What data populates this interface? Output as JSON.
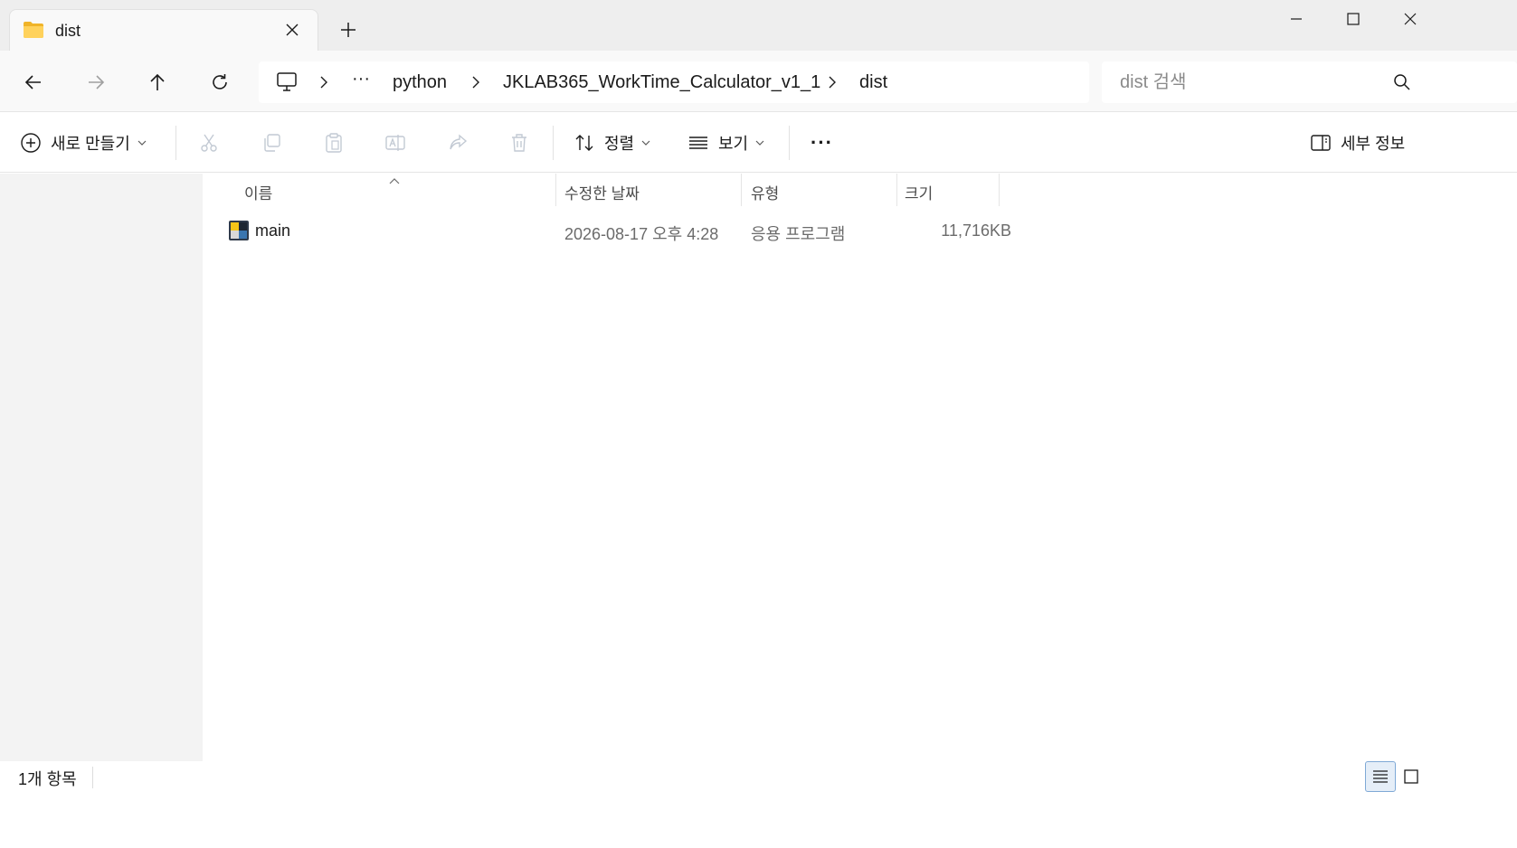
{
  "tab": {
    "title": "dist",
    "icon": "folder-icon"
  },
  "window_controls": [
    "minimize-icon",
    "maximize-icon",
    "close-icon"
  ],
  "breadcrumb": {
    "root_icon": "this-pc-icon",
    "overflow": "···",
    "items": [
      "python",
      "JKLAB365_WorkTime_Calculator_v1_1",
      "dist"
    ]
  },
  "search": {
    "placeholder": "dist 검색"
  },
  "commands": {
    "new_label": "새로 만들기",
    "sort_label": "정렬",
    "view_label": "보기",
    "more_label": "···",
    "details_label": "세부 정보"
  },
  "columns": {
    "name": "이름",
    "date": "수정한 날짜",
    "type": "유형",
    "size": "크기"
  },
  "files": [
    {
      "name": "main",
      "date": "2026-08-17 오후 4:28",
      "type": "응용 프로그램",
      "size": "11,716KB",
      "icon": "python-app-icon"
    }
  ],
  "status": {
    "item_count": "1개 항목"
  },
  "colors": {
    "accent": "#0067c0",
    "nav_bg": "#f3f3f3",
    "title_bg": "#eeeeee"
  }
}
